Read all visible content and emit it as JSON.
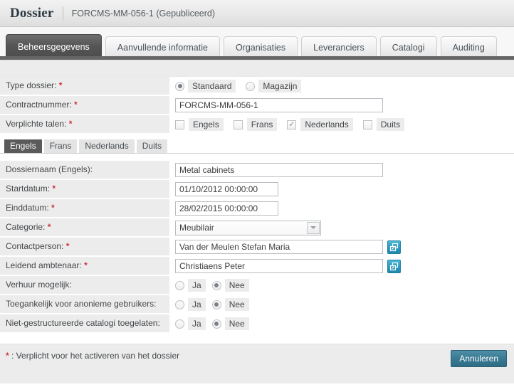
{
  "header": {
    "title": "Dossier",
    "subtitle": "FORCMS-MM-056-1 (Gepubliceerd)"
  },
  "tabs": [
    {
      "label": "Beheersgegevens",
      "active": true
    },
    {
      "label": "Aanvullende informatie",
      "active": false
    },
    {
      "label": "Organisaties",
      "active": false
    },
    {
      "label": "Leveranciers",
      "active": false
    },
    {
      "label": "Catalogi",
      "active": false
    },
    {
      "label": "Auditing",
      "active": false
    }
  ],
  "form": {
    "type_dossier": {
      "label": "Type dossier:",
      "required": "*",
      "options": [
        {
          "label": "Standaard",
          "selected": true
        },
        {
          "label": "Magazijn",
          "selected": false
        }
      ]
    },
    "contractnummer": {
      "label": "Contractnummer:",
      "required": "*",
      "value": "FORCMS-MM-056-1",
      "placeholder": ""
    },
    "verplichte_talen": {
      "label": "Verplichte talen:",
      "required": "*",
      "options": [
        {
          "label": "Engels",
          "checked": false
        },
        {
          "label": "Frans",
          "checked": false
        },
        {
          "label": "Nederlands",
          "checked": true
        },
        {
          "label": "Duits",
          "checked": false
        }
      ],
      "check_glyph": "✓"
    },
    "language_tabs": [
      {
        "label": "Engels",
        "active": true
      },
      {
        "label": "Frans",
        "active": false
      },
      {
        "label": "Nederlands",
        "active": false
      },
      {
        "label": "Duits",
        "active": false
      }
    ],
    "dossiernaam": {
      "label": "Dossiernaam (Engels):",
      "required": "",
      "value": "Metal cabinets",
      "placeholder": ""
    },
    "startdatum": {
      "label": "Startdatum:",
      "required": "*",
      "value": "01/10/2012 00:00:00",
      "placeholder": ""
    },
    "einddatum": {
      "label": "Einddatum:",
      "required": "*",
      "value": "28/02/2015 00:00:00",
      "placeholder": ""
    },
    "categorie": {
      "label": "Categorie:",
      "required": "*",
      "value": "Meubilair",
      "options": [
        "Meubilair"
      ]
    },
    "contactperson": {
      "label": "Contactperson:",
      "required": "*",
      "value": "Van der Meulen Stefan Maria",
      "placeholder": "",
      "lookup_icon": "popup-window-icon"
    },
    "leidend_ambtenaar": {
      "label": "Leidend ambtenaar:",
      "required": "*",
      "value": "Christiaens Peter",
      "placeholder": "",
      "lookup_icon": "popup-window-icon"
    },
    "verhuur_mogelijk": {
      "label": "Verhuur mogelijk:",
      "required": "",
      "options": [
        {
          "label": "Ja",
          "selected": false
        },
        {
          "label": "Nee",
          "selected": true
        }
      ]
    },
    "toegankelijk_anoniem": {
      "label": "Toegankelijk voor anonieme gebruikers:",
      "required": "",
      "options": [
        {
          "label": "Ja",
          "selected": false
        },
        {
          "label": "Nee",
          "selected": true
        }
      ]
    },
    "niet_gestructureerde_catalogi": {
      "label": "Niet-gestructureerde catalogi toegelaten:",
      "required": "",
      "options": [
        {
          "label": "Ja",
          "selected": false
        },
        {
          "label": "Nee",
          "selected": true
        }
      ]
    }
  },
  "footer": {
    "required_marker": "*",
    "note": ": Verplicht voor het activeren van het dossier",
    "cancel_label": "Annuleren"
  },
  "colors": {
    "accent_button": "#3b7b94",
    "lookup_button": "#2e9cc0",
    "required_star": "#cc3344",
    "active_tab": "#565656",
    "label_bg": "#ececec"
  }
}
